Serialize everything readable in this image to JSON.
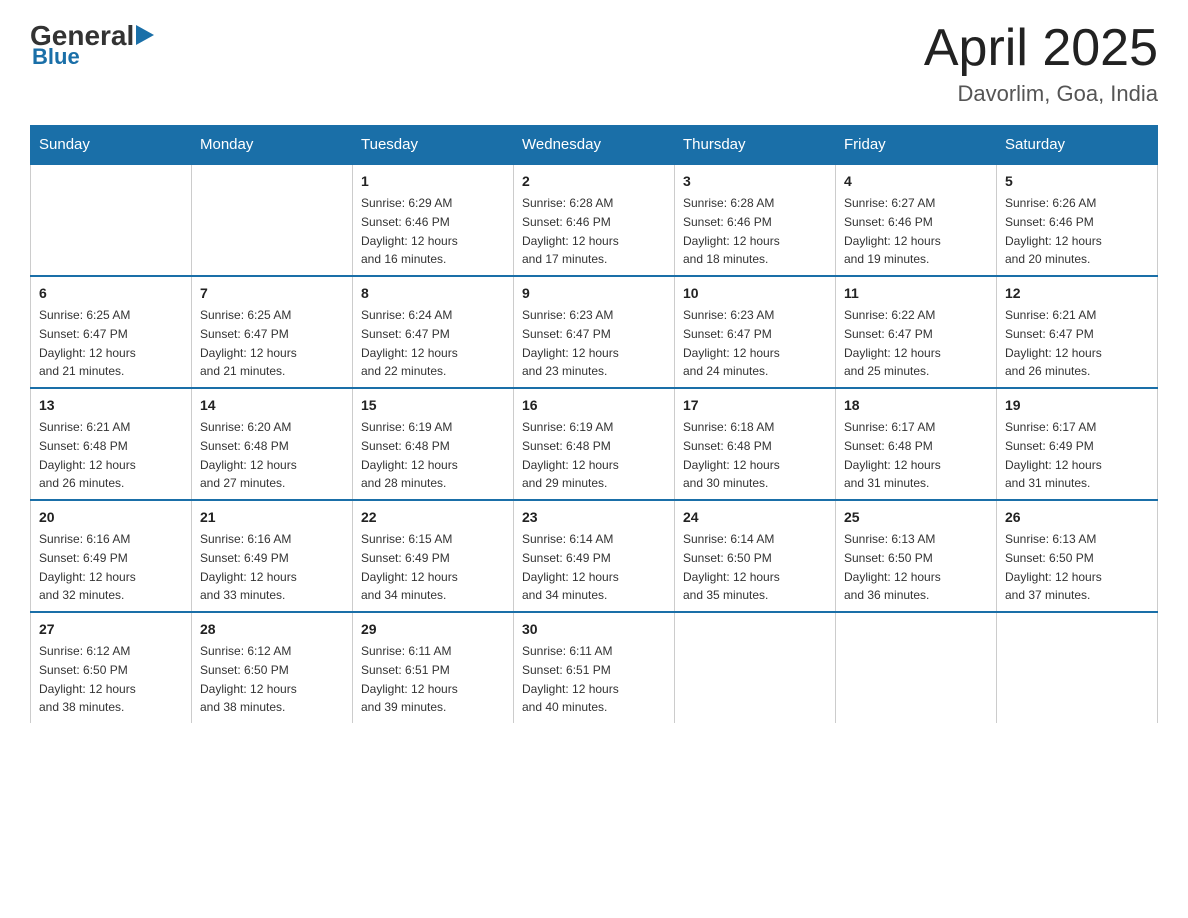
{
  "logo": {
    "general": "General",
    "blue": "Blue"
  },
  "header": {
    "month": "April 2025",
    "location": "Davorlim, Goa, India"
  },
  "days_of_week": [
    "Sunday",
    "Monday",
    "Tuesday",
    "Wednesday",
    "Thursday",
    "Friday",
    "Saturday"
  ],
  "weeks": [
    [
      {
        "day": "",
        "info": ""
      },
      {
        "day": "",
        "info": ""
      },
      {
        "day": "1",
        "info": "Sunrise: 6:29 AM\nSunset: 6:46 PM\nDaylight: 12 hours\nand 16 minutes."
      },
      {
        "day": "2",
        "info": "Sunrise: 6:28 AM\nSunset: 6:46 PM\nDaylight: 12 hours\nand 17 minutes."
      },
      {
        "day": "3",
        "info": "Sunrise: 6:28 AM\nSunset: 6:46 PM\nDaylight: 12 hours\nand 18 minutes."
      },
      {
        "day": "4",
        "info": "Sunrise: 6:27 AM\nSunset: 6:46 PM\nDaylight: 12 hours\nand 19 minutes."
      },
      {
        "day": "5",
        "info": "Sunrise: 6:26 AM\nSunset: 6:46 PM\nDaylight: 12 hours\nand 20 minutes."
      }
    ],
    [
      {
        "day": "6",
        "info": "Sunrise: 6:25 AM\nSunset: 6:47 PM\nDaylight: 12 hours\nand 21 minutes."
      },
      {
        "day": "7",
        "info": "Sunrise: 6:25 AM\nSunset: 6:47 PM\nDaylight: 12 hours\nand 21 minutes."
      },
      {
        "day": "8",
        "info": "Sunrise: 6:24 AM\nSunset: 6:47 PM\nDaylight: 12 hours\nand 22 minutes."
      },
      {
        "day": "9",
        "info": "Sunrise: 6:23 AM\nSunset: 6:47 PM\nDaylight: 12 hours\nand 23 minutes."
      },
      {
        "day": "10",
        "info": "Sunrise: 6:23 AM\nSunset: 6:47 PM\nDaylight: 12 hours\nand 24 minutes."
      },
      {
        "day": "11",
        "info": "Sunrise: 6:22 AM\nSunset: 6:47 PM\nDaylight: 12 hours\nand 25 minutes."
      },
      {
        "day": "12",
        "info": "Sunrise: 6:21 AM\nSunset: 6:47 PM\nDaylight: 12 hours\nand 26 minutes."
      }
    ],
    [
      {
        "day": "13",
        "info": "Sunrise: 6:21 AM\nSunset: 6:48 PM\nDaylight: 12 hours\nand 26 minutes."
      },
      {
        "day": "14",
        "info": "Sunrise: 6:20 AM\nSunset: 6:48 PM\nDaylight: 12 hours\nand 27 minutes."
      },
      {
        "day": "15",
        "info": "Sunrise: 6:19 AM\nSunset: 6:48 PM\nDaylight: 12 hours\nand 28 minutes."
      },
      {
        "day": "16",
        "info": "Sunrise: 6:19 AM\nSunset: 6:48 PM\nDaylight: 12 hours\nand 29 minutes."
      },
      {
        "day": "17",
        "info": "Sunrise: 6:18 AM\nSunset: 6:48 PM\nDaylight: 12 hours\nand 30 minutes."
      },
      {
        "day": "18",
        "info": "Sunrise: 6:17 AM\nSunset: 6:48 PM\nDaylight: 12 hours\nand 31 minutes."
      },
      {
        "day": "19",
        "info": "Sunrise: 6:17 AM\nSunset: 6:49 PM\nDaylight: 12 hours\nand 31 minutes."
      }
    ],
    [
      {
        "day": "20",
        "info": "Sunrise: 6:16 AM\nSunset: 6:49 PM\nDaylight: 12 hours\nand 32 minutes."
      },
      {
        "day": "21",
        "info": "Sunrise: 6:16 AM\nSunset: 6:49 PM\nDaylight: 12 hours\nand 33 minutes."
      },
      {
        "day": "22",
        "info": "Sunrise: 6:15 AM\nSunset: 6:49 PM\nDaylight: 12 hours\nand 34 minutes."
      },
      {
        "day": "23",
        "info": "Sunrise: 6:14 AM\nSunset: 6:49 PM\nDaylight: 12 hours\nand 34 minutes."
      },
      {
        "day": "24",
        "info": "Sunrise: 6:14 AM\nSunset: 6:50 PM\nDaylight: 12 hours\nand 35 minutes."
      },
      {
        "day": "25",
        "info": "Sunrise: 6:13 AM\nSunset: 6:50 PM\nDaylight: 12 hours\nand 36 minutes."
      },
      {
        "day": "26",
        "info": "Sunrise: 6:13 AM\nSunset: 6:50 PM\nDaylight: 12 hours\nand 37 minutes."
      }
    ],
    [
      {
        "day": "27",
        "info": "Sunrise: 6:12 AM\nSunset: 6:50 PM\nDaylight: 12 hours\nand 38 minutes."
      },
      {
        "day": "28",
        "info": "Sunrise: 6:12 AM\nSunset: 6:50 PM\nDaylight: 12 hours\nand 38 minutes."
      },
      {
        "day": "29",
        "info": "Sunrise: 6:11 AM\nSunset: 6:51 PM\nDaylight: 12 hours\nand 39 minutes."
      },
      {
        "day": "30",
        "info": "Sunrise: 6:11 AM\nSunset: 6:51 PM\nDaylight: 12 hours\nand 40 minutes."
      },
      {
        "day": "",
        "info": ""
      },
      {
        "day": "",
        "info": ""
      },
      {
        "day": "",
        "info": ""
      }
    ]
  ]
}
